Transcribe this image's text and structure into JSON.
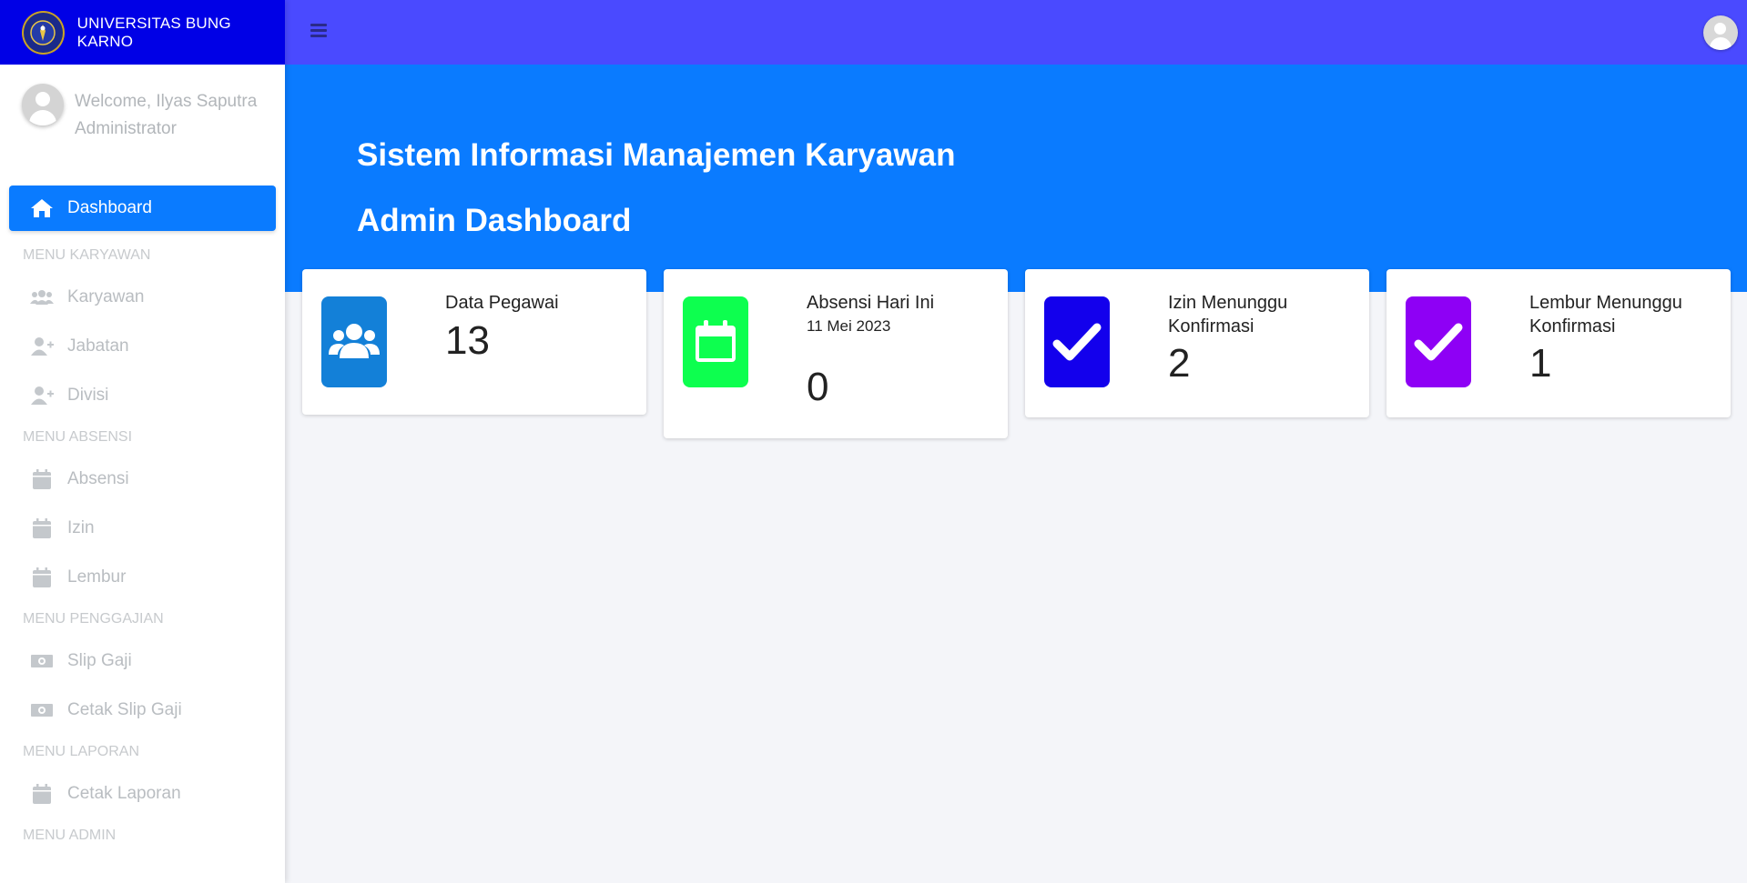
{
  "brand": {
    "name": "UNIVERSITAS BUNG KARNO"
  },
  "user": {
    "welcome": "Welcome, Ilyas Saputra",
    "role": "Administrator"
  },
  "sidebar": {
    "dashboard": "Dashboard",
    "sections": [
      {
        "header": "MENU KARYAWAN",
        "items": [
          "Karyawan",
          "Jabatan",
          "Divisi"
        ]
      },
      {
        "header": "MENU ABSENSI",
        "items": [
          "Absensi",
          "Izin",
          "Lembur"
        ]
      },
      {
        "header": "MENU PENGGAJIAN",
        "items": [
          "Slip Gaji",
          "Cetak Slip Gaji"
        ]
      },
      {
        "header": "MENU LAPORAN",
        "items": [
          "Cetak Laporan"
        ]
      },
      {
        "header": "MENU ADMIN",
        "items": []
      }
    ]
  },
  "hero": {
    "title": "Sistem Informasi Manajemen Karyawan",
    "subtitle": "Admin Dashboard"
  },
  "cards": [
    {
      "label": "Data Pegawai",
      "value": "13",
      "icon": "users-icon",
      "color": "#1380d8"
    },
    {
      "label": "Absensi Hari Ini",
      "date": "11 Mei 2023",
      "value": "0",
      "icon": "calendar-icon",
      "color": "#0dff4f"
    },
    {
      "label": "Izin Menunggu Konfirmasi",
      "value": "2",
      "icon": "check-icon",
      "color": "#1300ec"
    },
    {
      "label": "Lembur Menunggu Konfirmasi",
      "value": "1",
      "icon": "check-icon",
      "color": "#8e00f5"
    }
  ],
  "colors": {
    "brand": "#0000e6",
    "topbar": "#4a4aff",
    "primary": "#0a7bff"
  }
}
